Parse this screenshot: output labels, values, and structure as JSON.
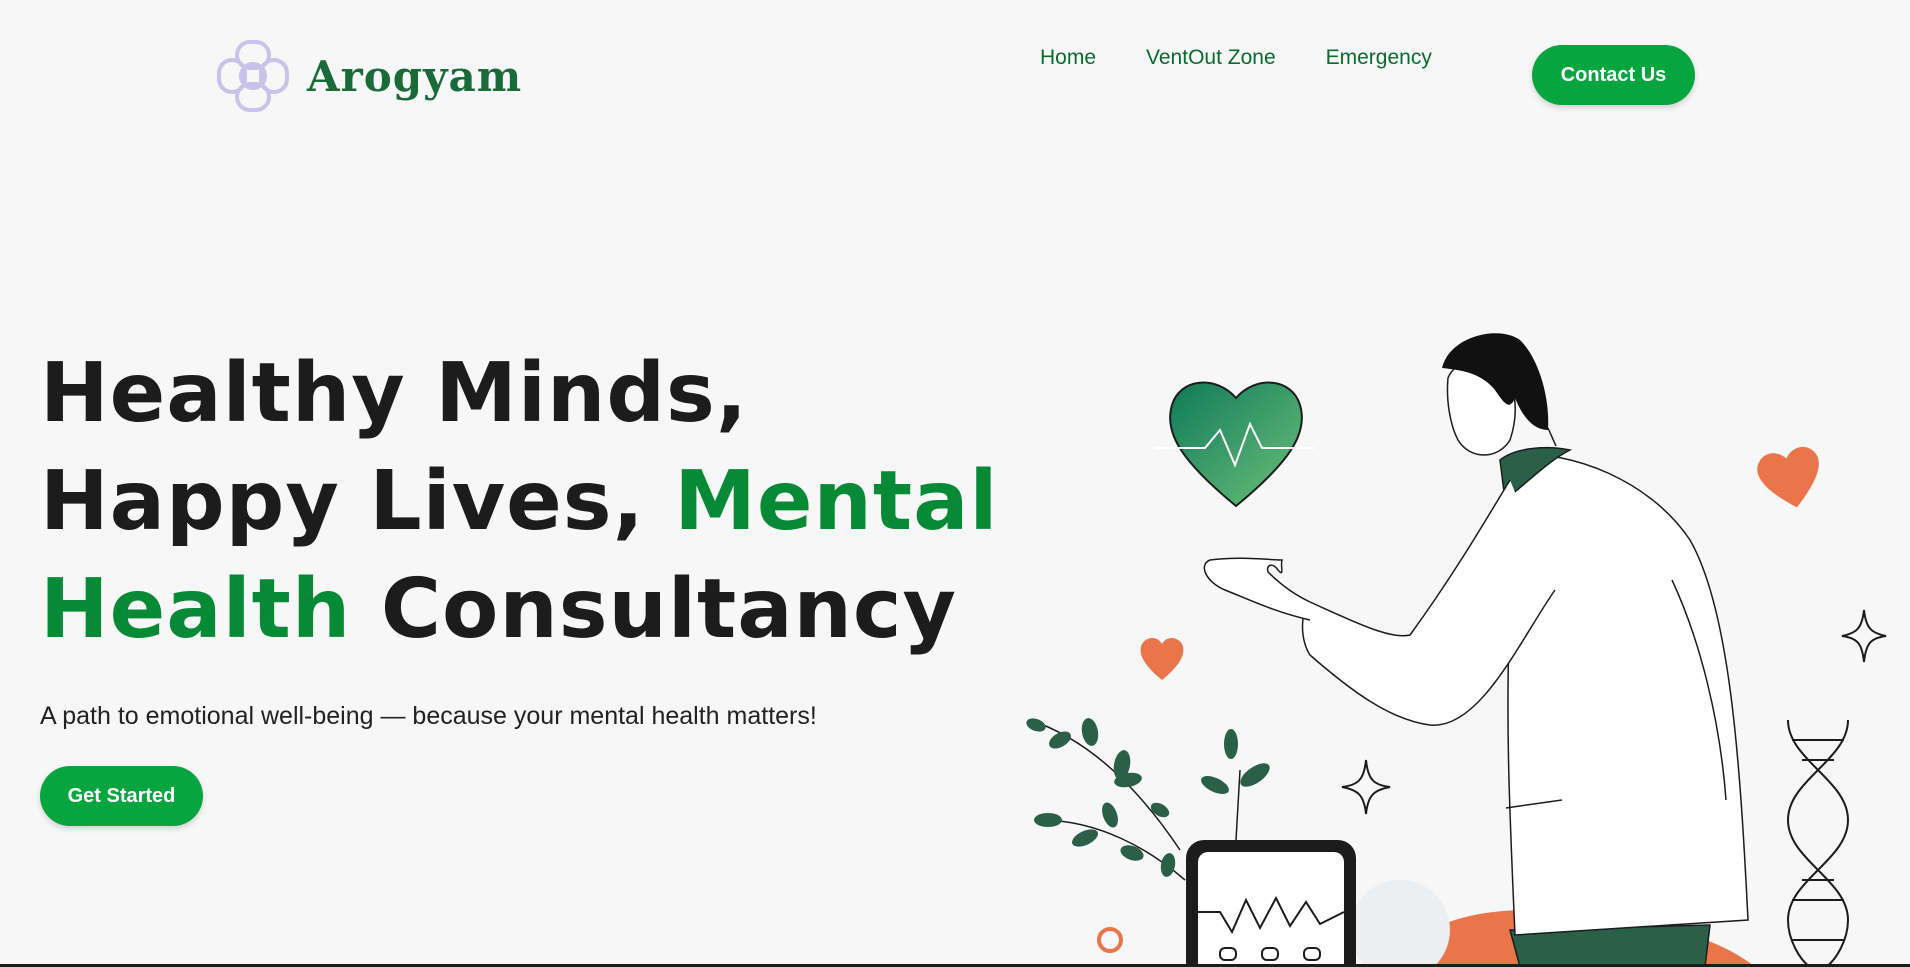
{
  "brand": {
    "name": "Arogyam"
  },
  "nav": {
    "items": [
      {
        "label": "Home"
      },
      {
        "label": "VentOut Zone"
      },
      {
        "label": "Emergency"
      }
    ],
    "contact_label": "Contact Us"
  },
  "hero": {
    "line1": "Healthy Minds,",
    "line2_plain": "Happy Lives, ",
    "line2_accent": "Mental",
    "line3_accent": "Health",
    "line3_plain": " Consultancy",
    "subtitle": "A path to emotional well-being — because your mental health matters!",
    "cta_label": "Get Started"
  },
  "colors": {
    "background": "#f7f7f7",
    "accent_green": "#078a36",
    "button_green": "#07a53f",
    "heading_dark": "#1c1c1c",
    "logo_purple": "#c9c2ea",
    "heart_orange": "#ea754a",
    "leaf_green": "#2a6048"
  }
}
